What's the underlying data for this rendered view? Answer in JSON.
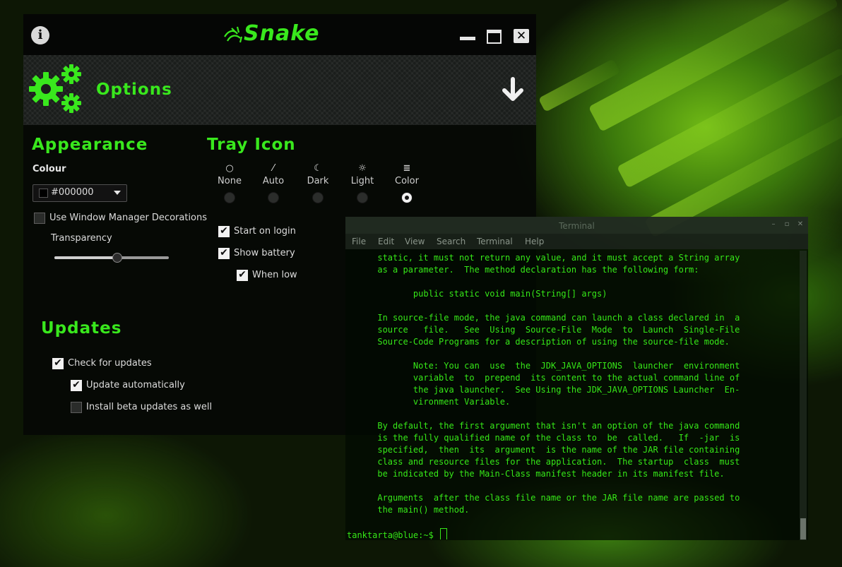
{
  "snake": {
    "app_name": "Snake",
    "page_title": "Options",
    "appearance": {
      "title": "Appearance",
      "colour_label": "Colour",
      "colour_value": "#000000",
      "colour_swatch": "#000000",
      "use_wm_decorations": {
        "label": "Use Window Manager Decorations",
        "checked": false
      },
      "transparency_label": "Transparency",
      "transparency_value": 0.55
    },
    "tray_icon": {
      "title": "Tray Icon",
      "options": [
        {
          "label": "None",
          "icon": "circle-icon",
          "selected": false
        },
        {
          "label": "Auto",
          "icon": "magic-wand-icon",
          "selected": false
        },
        {
          "label": "Dark",
          "icon": "moon-icon",
          "selected": false
        },
        {
          "label": "Light",
          "icon": "sun-icon",
          "selected": false
        },
        {
          "label": "Color",
          "icon": "bars-icon",
          "selected": true
        }
      ],
      "start_on_login": {
        "label": "Start on login",
        "checked": true
      },
      "show_battery": {
        "label": "Show battery",
        "checked": true
      },
      "when_low": {
        "label": "When low",
        "checked": true
      }
    },
    "updates": {
      "title": "Updates",
      "check_for_updates": {
        "label": "Check for updates",
        "checked": true
      },
      "update_automatically": {
        "label": "Update automatically",
        "checked": true
      },
      "install_beta": {
        "label": "Install beta updates as well",
        "checked": false
      }
    },
    "colors": {
      "accent": "#39e81d",
      "background": "#060806"
    }
  },
  "terminal": {
    "title": "Terminal",
    "menu": [
      "File",
      "Edit",
      "View",
      "Search",
      "Terminal",
      "Help"
    ],
    "lines": [
      "      static, it must not return any value, and it must accept a String array",
      "      as a parameter.  The method declaration has the following form:",
      "",
      "             public static void main(String[] args)",
      "",
      "      In source-file mode, the java command can launch a class declared in  a",
      "      source   file.   See  Using  Source-File  Mode  to  Launch  Single-File",
      "      Source-Code Programs for a description of using the source-file mode.",
      "",
      "             Note: You can  use  the  JDK_JAVA_OPTIONS  launcher  environment",
      "             variable  to  prepend  its content to the actual command line of",
      "             the java launcher.  See Using the JDK_JAVA_OPTIONS Launcher  En-",
      "             vironment Variable.",
      "",
      "      By default, the first argument that isn't an option of the java command",
      "      is the fully qualified name of the class to  be  called.   If  -jar  is",
      "      specified,  then  its  argument  is the name of the JAR file containing",
      "      class and resource files for the application.  The startup  class  must",
      "      be indicated by the Main-Class manifest header in its manifest file.",
      "",
      "      Arguments  after the class file name or the JAR file name are passed to",
      "      the main() method.",
      "",
      "tanktarta@blue:~$ "
    ],
    "text_color": "#36e818"
  }
}
